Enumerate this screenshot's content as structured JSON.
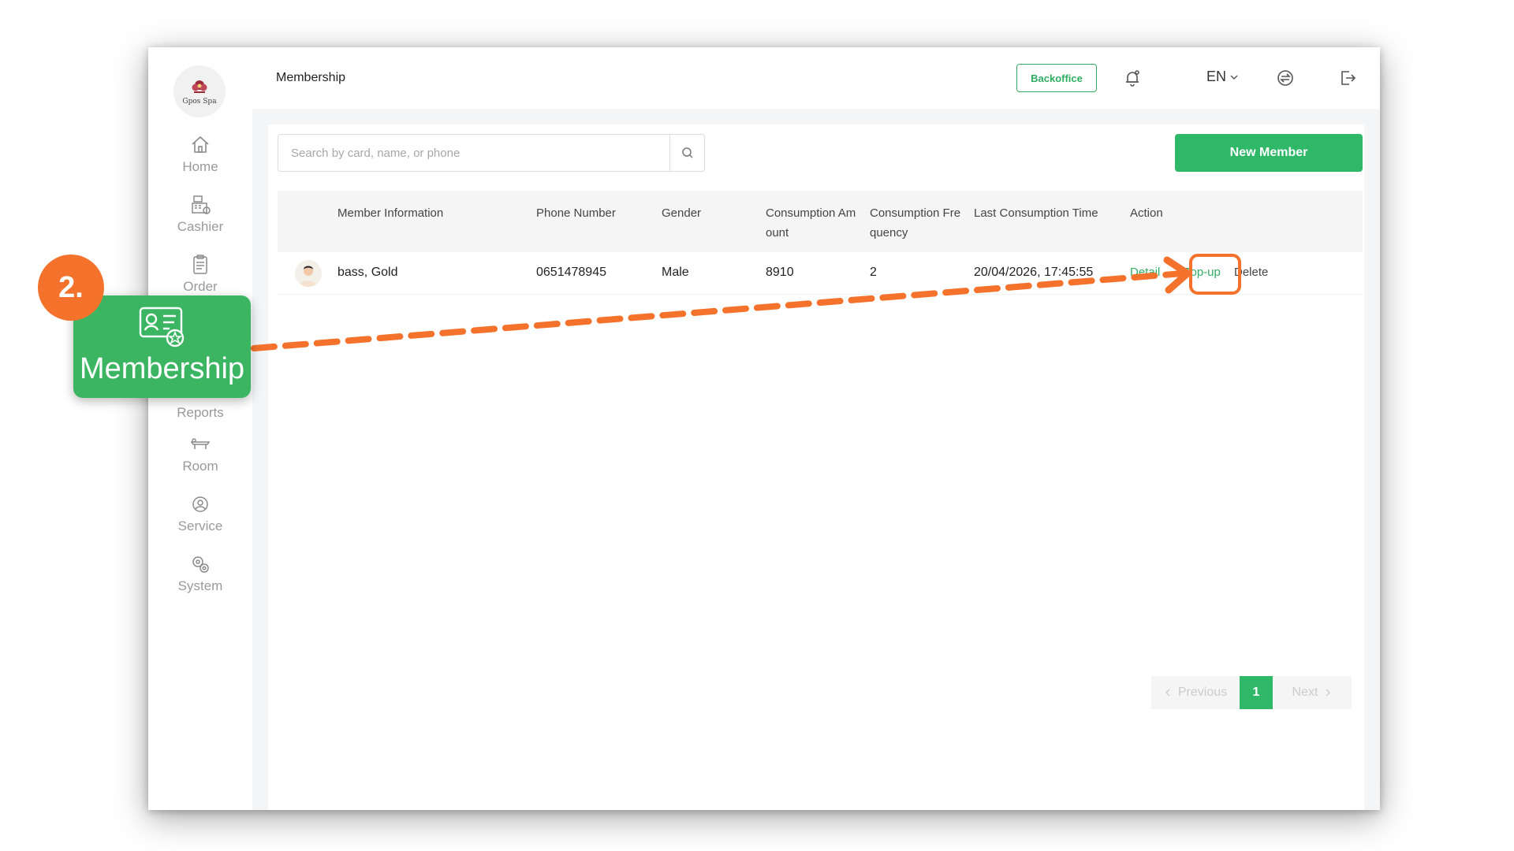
{
  "app": {
    "logo_text": "Gpos Spa",
    "page_title": "Membership"
  },
  "header": {
    "backoffice_label": "Backoffice",
    "language": "EN"
  },
  "sidebar": {
    "items": [
      {
        "label": "Home",
        "icon": "home-icon"
      },
      {
        "label": "Cashier",
        "icon": "cashier-icon"
      },
      {
        "label": "Order",
        "icon": "order-icon"
      },
      {
        "label": "Reports",
        "icon": "reports-icon"
      },
      {
        "label": "Room",
        "icon": "room-icon"
      },
      {
        "label": "Service",
        "icon": "service-icon"
      },
      {
        "label": "System",
        "icon": "system-icon"
      }
    ]
  },
  "search": {
    "placeholder": "Search by card, name, or phone",
    "value": ""
  },
  "toolbar": {
    "new_member_label": "New Member"
  },
  "table": {
    "columns": [
      "Member Information",
      "Phone Number",
      "Gender",
      "Consumption Am\nount",
      "Consumption Fre\nquency",
      "Last Consumption Time",
      "Action"
    ],
    "rows": [
      {
        "name": "bass, Gold",
        "phone": "0651478945",
        "gender": "Male",
        "consumption_amount": "8910",
        "consumption_frequency": "2",
        "last_consumption_time": "20/04/2026, 17:45:55",
        "actions": {
          "detail": "Detail",
          "topup": "Top-up",
          "delete": "Delete"
        }
      }
    ]
  },
  "pagination": {
    "previous_label": "Previous",
    "current_page": "1",
    "next_label": "Next"
  },
  "tutorial": {
    "step_label": "2.",
    "callout_label": "Membership",
    "accent_color": "#f4722b",
    "brand_color": "#2fb868"
  }
}
